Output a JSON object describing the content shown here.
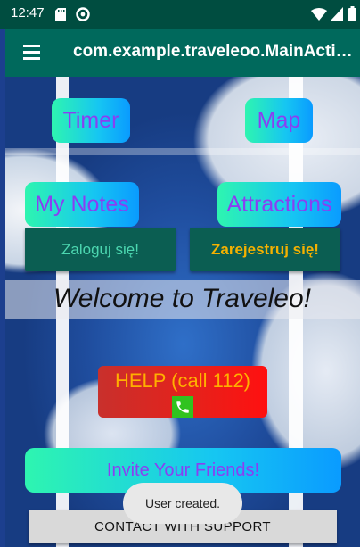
{
  "status_bar": {
    "time": "12:47",
    "left_icons": [
      "sd-card-icon",
      "at-sign-icon"
    ],
    "right_icons": [
      "wifi-icon",
      "signal-icon",
      "battery-icon"
    ]
  },
  "app_bar": {
    "title": "com.example.traveleoo.MainActivity",
    "menu_icon": "hamburger-menu-icon"
  },
  "buttons": {
    "timer": "Timer",
    "map": "Map",
    "my_notes": "My Notes",
    "attractions": "Attractions",
    "login": "Zaloguj się!",
    "register": "Zarejestruj się!",
    "help": "HELP (call 112)",
    "invite": "Invite Your Friends!",
    "support": "CONTACT WITH SUPPORT"
  },
  "welcome_text": "Welcome to Traveleo!",
  "toast": "User created.",
  "colors": {
    "status_bar": "#004d40",
    "app_bar": "#00695c",
    "gradient_start": "#2ef5b0",
    "gradient_end": "#0a9bff",
    "gradient_text": "#8a3ff2",
    "dark_button": "#0b5e52",
    "login_text": "#4cd7b0",
    "register_text": "#f5b100",
    "help_bg": "#e8201a",
    "help_text": "#ffb000",
    "phone_icon_bg": "#31c31f"
  }
}
